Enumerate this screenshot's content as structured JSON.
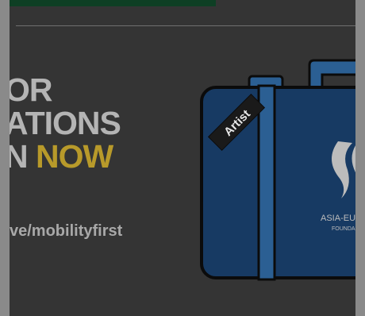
{
  "banner": {
    "headline_lines": [
      "OR",
      "ATIONS"
    ],
    "headline_last_prefix": "N",
    "headline_accent_word": "NOW",
    "url_text": "ve/mobilityfirst",
    "luggage_tag_text": "Artist",
    "logo_name_line1": "ASIA-EU",
    "logo_name_line2": "FOUNDA"
  },
  "colors": {
    "background": "#343434",
    "side_gutter": "#8a8a8a",
    "top_strip": "#0e3f24",
    "headline_text": "#b4b4b4",
    "accent_text": "#b89a2a",
    "suitcase_body": "#173a63",
    "suitcase_outline": "#0b0b0b",
    "suitcase_stripe": "#2b5f93"
  },
  "icons": {
    "suitcase": "suitcase-illustration",
    "logo": "asef-logo-icon"
  }
}
